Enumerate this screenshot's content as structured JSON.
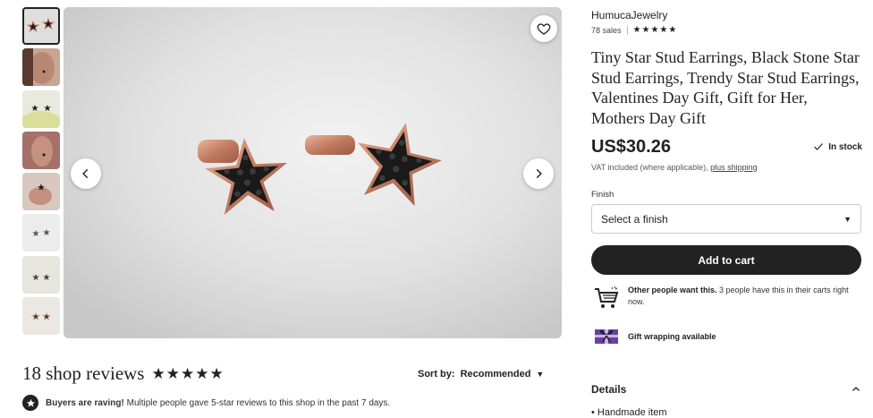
{
  "gallery": {
    "thumbnails": [
      {
        "name": "thumb-1-stars-closeup",
        "active": true
      },
      {
        "name": "thumb-2-ear-model"
      },
      {
        "name": "thumb-3-stars-on-stand"
      },
      {
        "name": "thumb-4-ear-closeup"
      },
      {
        "name": "thumb-5-hand-holding"
      },
      {
        "name": "thumb-6-stars-white"
      },
      {
        "name": "thumb-7-stars-white"
      },
      {
        "name": "thumb-8-stars-white"
      }
    ],
    "favorite_icon": "heart-icon",
    "prev_icon": "chevron-left-icon",
    "next_icon": "chevron-right-icon"
  },
  "listing": {
    "shop_name": "HumucaJewelry",
    "sales": "78 sales",
    "shop_stars": "★★★★★",
    "title": "Tiny Star Stud Earrings, Black Stone Star Stud Earrings, Trendy Star Stud Earrings, Valentines Day Gift, Gift for Her, Mothers Day Gift",
    "price": "US$30.26",
    "stock": "In stock",
    "vat_text": "VAT included (where applicable),",
    "shipping_link": "plus shipping",
    "finish_label": "Finish",
    "finish_placeholder": "Select a finish",
    "add_to_cart": "Add to cart",
    "demand_bold": "Other people want this.",
    "demand_text": "3 people have this in their carts right now.",
    "gift_wrap": "Gift wrapping available",
    "details_label": "Details",
    "details_first_item": "Handmade item"
  },
  "reviews": {
    "title": "18 shop reviews",
    "stars": "★★★★★",
    "sort_label": "Sort by:",
    "sort_value": "Recommended",
    "raving_bold": "Buyers are raving!",
    "raving_text": "Multiple people gave 5-star reviews to this shop in the past 7 days."
  },
  "colors": {
    "primary": "#222222",
    "rose_gold": "#c98a6e",
    "gift_purple": "#6b3fa0"
  }
}
